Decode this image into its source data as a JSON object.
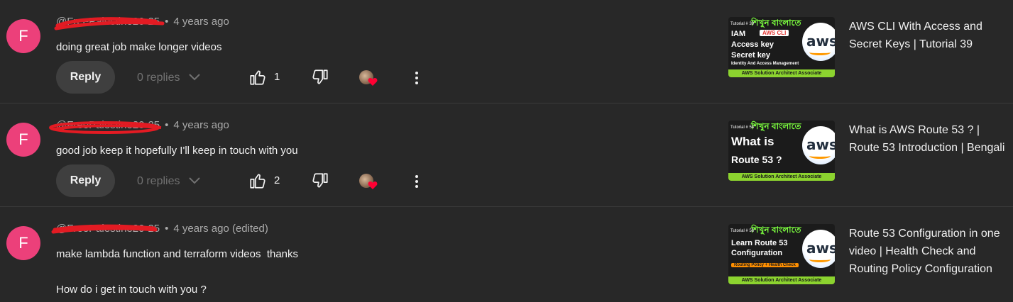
{
  "comments": [
    {
      "avatar_letter": "F",
      "handle": "@FreePalestine20-25",
      "time": "4 years ago",
      "text": "doing great job make longer videos",
      "reply_label": "Reply",
      "replies": "0 replies",
      "likes": "1",
      "video": {
        "title": "AWS CLI With Access and Secret Keys | Tutorial 39",
        "thumb_banner": "শিখুন বাংলাতে",
        "thumb_tutorial": "Tutorial # 39",
        "thumb_lines": [
          "IAM",
          "Access key",
          "Secret key",
          "Identity And Access Management"
        ],
        "thumb_tag": "AWS CLI",
        "thumb_logo": "aws",
        "thumb_footer": "AWS Solution Architect Associate"
      }
    },
    {
      "avatar_letter": "F",
      "handle": "@FreePalestine20-25",
      "time": "4 years ago",
      "text": "good job keep it hopefully I'll keep in touch with you",
      "reply_label": "Reply",
      "replies": "0 replies",
      "likes": "2",
      "video": {
        "title": "What is AWS Route 53 ? | Route 53 Introduction | Bengali",
        "thumb_banner": "শিখুন বাংলাতে",
        "thumb_tutorial": "Tutorial # 54",
        "thumb_lines": [
          "What is",
          "Route 53 ?"
        ],
        "thumb_logo": "aws",
        "thumb_footer": "AWS Solution Architect Associate"
      }
    },
    {
      "avatar_letter": "F",
      "handle": "@FreePalestine20-25",
      "time": "4 years ago (edited)",
      "text": "make lambda function and terraform videos  thanks\n\nHow do i get in touch with you ?",
      "video": {
        "title": "Route 53 Configuration in one video | Health Check and Routing Policy Configuration",
        "thumb_banner": "শিখুন বাংলাতে",
        "thumb_tutorial": "Tutorial # 56",
        "thumb_lines": [
          "Learn Route 53",
          "Configuration"
        ],
        "thumb_tag": "Routing Policy + Health Check",
        "thumb_logo": "aws",
        "thumb_footer": "AWS Solution Architect Associate"
      }
    }
  ],
  "colors": {
    "background": "#282828",
    "avatar": "#ec407a",
    "redaction": "#e31b23",
    "heart": "#ff0033"
  }
}
